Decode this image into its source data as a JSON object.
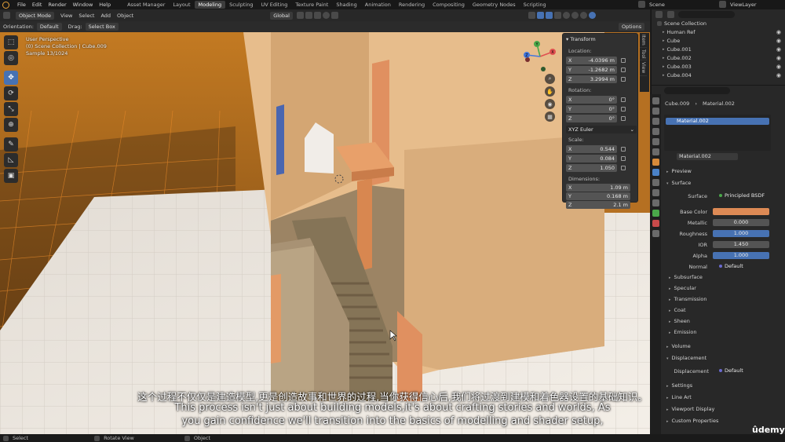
{
  "topbar": {
    "menus": [
      "File",
      "Edit",
      "Render",
      "Window",
      "Help"
    ],
    "workspaces": [
      "Asset Manager",
      "Layout",
      "Modeling",
      "Sculpting",
      "UV Editing",
      "Texture Paint",
      "Shading",
      "Animation",
      "Rendering",
      "Compositing",
      "Geometry Nodes",
      "Scripting"
    ],
    "active_workspace": "Modeling",
    "scene": "Scene",
    "view_layer": "ViewLayer"
  },
  "viewport_header": {
    "mode": "Object Mode",
    "menus": [
      "View",
      "Select",
      "Add",
      "Object"
    ],
    "transform": "Global",
    "orientation_label": "Orientation:",
    "orientation": "Default",
    "drag_label": "Drag:",
    "drag": "Select Box",
    "options": "Options"
  },
  "viewport_overlay": {
    "line1": "User Perspective",
    "line2": "(0) Scene Collection | Cube.009",
    "line3": "Sample 13/1024"
  },
  "gizmo": {
    "x": "X",
    "y": "Y",
    "z": "Z"
  },
  "npanel": {
    "title": "Transform",
    "tabs": [
      "Item",
      "Tool",
      "View"
    ],
    "location_label": "Location:",
    "location": [
      {
        "axis": "X",
        "value": "-4.0396 m"
      },
      {
        "axis": "Y",
        "value": "-1.2682 m"
      },
      {
        "axis": "Z",
        "value": "3.2994 m"
      }
    ],
    "rotation_label": "Rotation:",
    "rotation": [
      {
        "axis": "X",
        "value": "0°"
      },
      {
        "axis": "Y",
        "value": "0°"
      },
      {
        "axis": "Z",
        "value": "0°"
      }
    ],
    "rotation_mode": "XYZ Euler",
    "scale_label": "Scale:",
    "scale": [
      {
        "axis": "X",
        "value": "0.544"
      },
      {
        "axis": "Y",
        "value": "0.084"
      },
      {
        "axis": "Z",
        "value": "1.050"
      }
    ],
    "dimensions_label": "Dimensions:",
    "dimensions": [
      {
        "axis": "X",
        "value": "1.09 m"
      },
      {
        "axis": "Y",
        "value": "0.168 m"
      },
      {
        "axis": "Z",
        "value": "2.1 m"
      }
    ]
  },
  "outliner": {
    "root": "Scene Collection",
    "items": [
      "Human Ref",
      "Cube",
      "Cube.001",
      "Cube.002",
      "Cube.003",
      "Cube.004"
    ]
  },
  "properties": {
    "object": "Cube.009",
    "material_breadcrumb": "Material.002",
    "slot": "Material.002",
    "material_name": "Material.002",
    "preview": "Preview",
    "surface_section": "Surface",
    "surface_label": "Surface",
    "surface_value": "Principled BSDF",
    "base_color_label": "Base Color",
    "base_color": "#dd8a55",
    "metallic_label": "Metallic",
    "metallic": "0.000",
    "roughness_label": "Roughness",
    "roughness": "1.000",
    "ior_label": "IOR",
    "ior": "1.450",
    "alpha_label": "Alpha",
    "alpha": "1.000",
    "normal_label": "Normal",
    "normal": "Default",
    "subsections": [
      "Subsurface",
      "Specular",
      "Transmission",
      "Coat",
      "Sheen",
      "Emission"
    ],
    "volume": "Volume",
    "displacement_section": "Displacement",
    "displacement_label": "Displacement",
    "displacement_value": "Default",
    "settings": "Settings",
    "line_art": "Line Art",
    "viewport_display": "Viewport Display",
    "custom_properties": "Custom Properties"
  },
  "status": {
    "select": "Select",
    "rotate": "Rotate View",
    "object": "Object"
  },
  "subtitles": {
    "cn": "这个过程不仅仅是建造模型,更是创造故事和世界的过程,当你获得信心后,我们将过渡到建模和着色器设置的基础知识。",
    "en1": "This process isn't just about building models,it's about crafting stories and worlds, As",
    "en2": "you gain confidence we'll transition into the basics of modelling and shader setup,"
  },
  "watermark": "ûdemy"
}
